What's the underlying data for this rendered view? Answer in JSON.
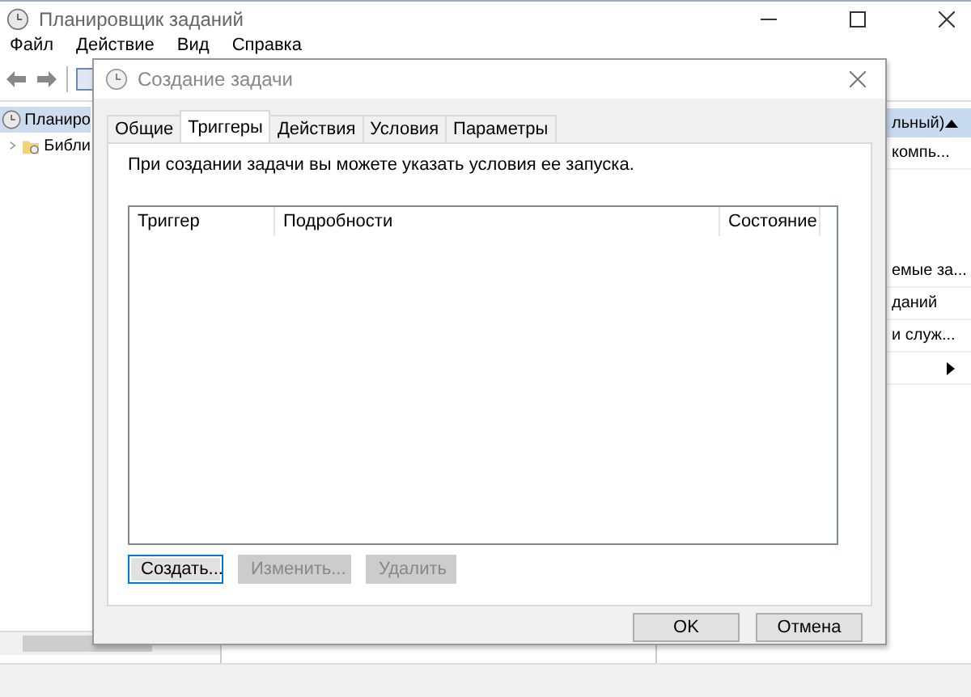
{
  "main_window": {
    "title": "Планировщик заданий",
    "menu": [
      "Файл",
      "Действие",
      "Вид",
      "Справка"
    ],
    "tree": [
      {
        "label": "Планиро",
        "selected": true,
        "children": [
          {
            "label": "Библи",
            "expanded": false
          }
        ]
      }
    ],
    "actions_panel": {
      "header": "льный)",
      "items": [
        {
          "kind": "action",
          "label": "компь..."
        },
        {
          "kind": "action",
          "label": "емые за..."
        },
        {
          "kind": "action",
          "label": "даний"
        },
        {
          "kind": "action",
          "label": "и служ..."
        },
        {
          "kind": "submenu"
        }
      ]
    }
  },
  "dialog": {
    "title": "Создание задачи",
    "tabs": [
      {
        "label": "Общие",
        "selected": false
      },
      {
        "label": "Триггеры",
        "selected": true
      },
      {
        "label": "Действия",
        "selected": false
      },
      {
        "label": "Условия",
        "selected": false
      },
      {
        "label": "Параметры",
        "selected": false
      }
    ],
    "description": "При создании задачи вы можете указать условия ее запуска.",
    "table": {
      "columns": [
        "Триггер",
        "Подробности",
        "Состояние"
      ]
    },
    "buttons": [
      {
        "label": "Создать...",
        "disabled": false,
        "focused": true
      },
      {
        "label": "Изменить...",
        "disabled": true,
        "focused": false
      },
      {
        "label": "Удалить",
        "disabled": true,
        "focused": false
      }
    ],
    "footer_buttons": [
      "OK",
      "Отмена"
    ]
  }
}
